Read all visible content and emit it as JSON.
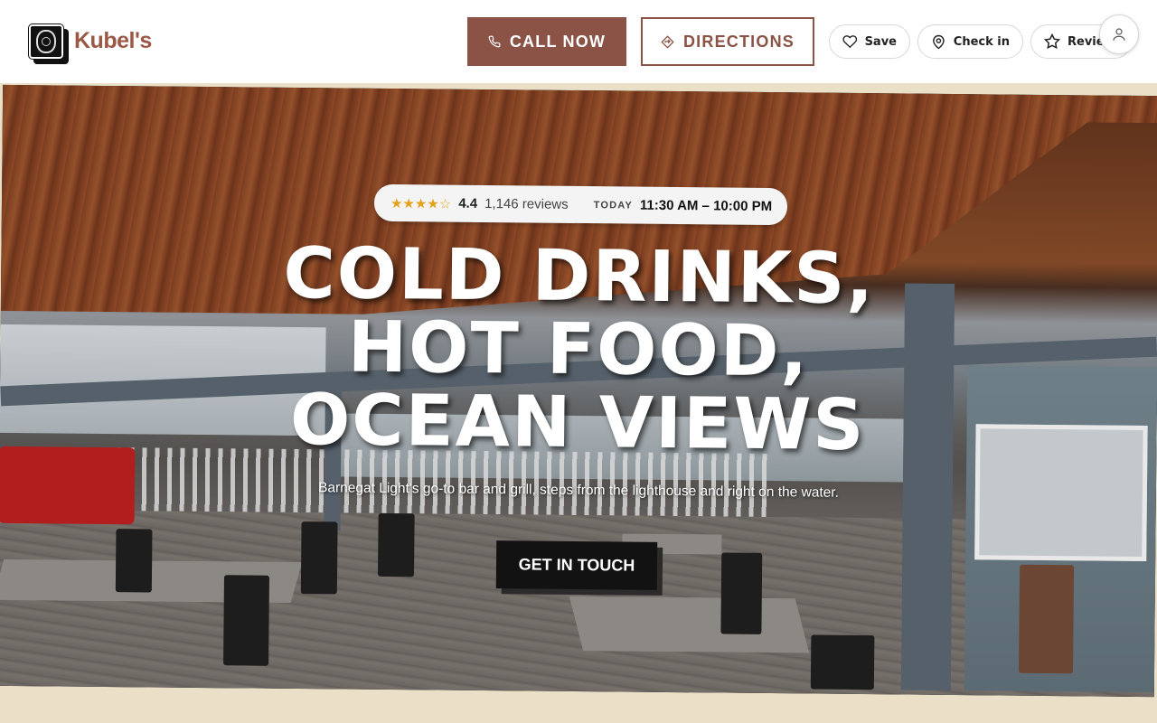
{
  "header": {
    "brand": "Kubel's",
    "call_label": "CALL NOW",
    "directions_label": "DIRECTIONS",
    "save_label": "Save",
    "checkin_label": "Check in",
    "review_label": "Review"
  },
  "hero": {
    "rating_stars": "★★★★☆",
    "rating": "4.4",
    "reviews": "1,146 reviews",
    "today_label": "TODAY",
    "hours": "11:30 AM – 10:00 PM",
    "headline": [
      "COLD DRINKS,",
      "HOT FOOD,",
      "OCEAN VIEWS"
    ],
    "subline": "Barnegat Light's go-to bar and grill, steps from the lighthouse and right on the water.",
    "cta_label": "GET IN TOUCH"
  },
  "colors": {
    "brand": "#9c5846",
    "call_bg": "#8a5346",
    "page_bg": "#eadfc7",
    "star": "#e2a21a",
    "cta_bg": "#121212"
  },
  "icons": [
    "phone-icon",
    "directions-icon",
    "heart-icon",
    "map-pin-icon",
    "star-icon",
    "user-icon"
  ]
}
